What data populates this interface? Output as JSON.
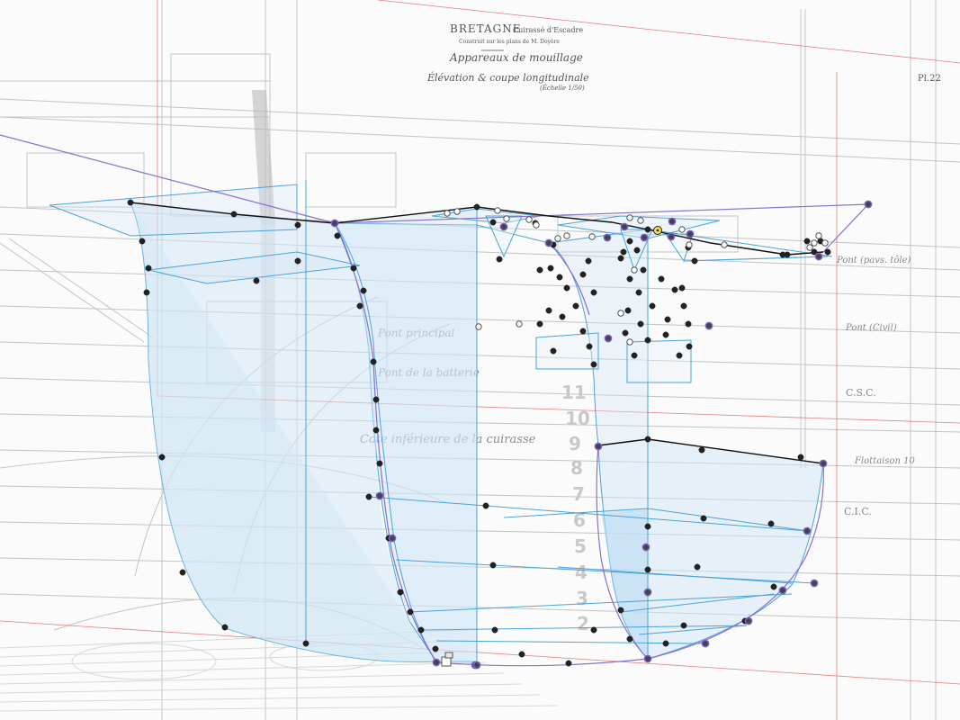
{
  "drawing": {
    "title": "BRETAGNE",
    "subtitle": "Cuirassé d'Escadre",
    "caption": "Construit sur les plans de M. Doyère",
    "heading": "Appareaux de mouillage",
    "view": "Élévation & coupe longitudinale",
    "scale": "(Échelle 1/50)",
    "plate": "Pl.22"
  },
  "annotations": {
    "pont_cote": "Pont (pavs. tôle)",
    "pont_civil": "Pont (Civil)",
    "csc": "C.S.C.",
    "cic": "C.I.C.",
    "pont_principal": "Pont principal",
    "pont_batterie": "Pont de la batterie",
    "cote_inferieur": "Cote inférieure de la cuirasse",
    "flottaison": "Flottaison 10"
  },
  "draft_marks": [
    "11",
    "10",
    "9",
    "8",
    "7",
    "6",
    "5",
    "4",
    "3",
    "2"
  ],
  "colors": {
    "surface_fill": "#cfe6f6",
    "surface_stroke": "#4aa3d8",
    "curve_purple": "#8a6fd0",
    "curve_black": "#111111",
    "point_black": "#222222",
    "point_outline": "#7a5fc8",
    "highlight_yellow": "#f4e04a",
    "drawing_line": "#bdbdbd",
    "frame_red": "#d94a4a"
  }
}
